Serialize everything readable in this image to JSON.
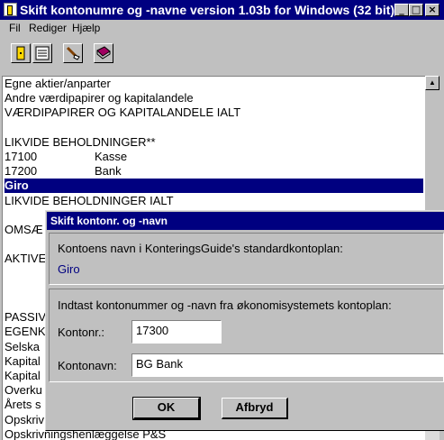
{
  "window": {
    "title": "Skift kontonumre og -navne   version 1.03b for Windows (32 bit)",
    "controls": {
      "minimize": "_",
      "maximize": "□",
      "close": "×"
    }
  },
  "menu": {
    "file": "Fil",
    "edit": "Rediger",
    "help": "Hjælp"
  },
  "toolbar": {
    "icons": [
      "exit-door-icon",
      "list-icon",
      "edit-brush-icon",
      "book-icon"
    ]
  },
  "list": {
    "rows": [
      {
        "code": "",
        "name": "Egne aktier/anparter"
      },
      {
        "code": "",
        "name": "Andre værdipapirer og kapitalandele"
      },
      {
        "code": "",
        "name": "VÆRDIPAPIRER OG KAPITALANDELE IALT"
      },
      {
        "code": "",
        "name": ""
      },
      {
        "code": "",
        "name": "LIKVIDE BEHOLDNINGER**"
      },
      {
        "code": "17100",
        "name": "Kasse"
      },
      {
        "code": "17200",
        "name": "Bank"
      },
      {
        "code": "",
        "name": "Giro"
      },
      {
        "code": "",
        "name": "LIKVIDE BEHOLDNINGER IALT"
      },
      {
        "code": "",
        "name": ""
      },
      {
        "code": "",
        "name": "OMSÆ"
      },
      {
        "code": "",
        "name": ""
      },
      {
        "code": "",
        "name": "AKTIVE"
      },
      {
        "code": "",
        "name": ""
      },
      {
        "code": "",
        "name": ""
      },
      {
        "code": "",
        "name": ""
      },
      {
        "code": "",
        "name": "PASSIV"
      },
      {
        "code": "",
        "name": "EGENK"
      },
      {
        "code": "",
        "name": "Selska"
      },
      {
        "code": "",
        "name": "Kapital"
      },
      {
        "code": "",
        "name": "Kapital"
      },
      {
        "code": "",
        "name": "Overku"
      },
      {
        "code": "",
        "name": "Årets s"
      },
      {
        "code": "",
        "name": "Opskriv"
      },
      {
        "code": "",
        "name": "Opskrivningshenlæggelse P&S"
      }
    ],
    "selected_index": 7
  },
  "dialog": {
    "title": "Skift kontonr. og -navn",
    "standard_label": "Kontoens navn i KonteringsGuide's standardkontoplan:",
    "standard_value": "Giro",
    "input_label": "Indtast kontonummer og -navn fra økonomisystemets kontoplan:",
    "kontonr_label": "Kontonr.:",
    "kontonr_value": "17300",
    "kontonavn_label": "Kontonavn:",
    "kontonavn_value": "BG Bank",
    "ok_label": "OK",
    "cancel_label": "Afbryd"
  },
  "colors": {
    "titlebar": "#000080",
    "selection": "#000080",
    "face": "#c0c0c0",
    "standard_value": "#000080"
  }
}
